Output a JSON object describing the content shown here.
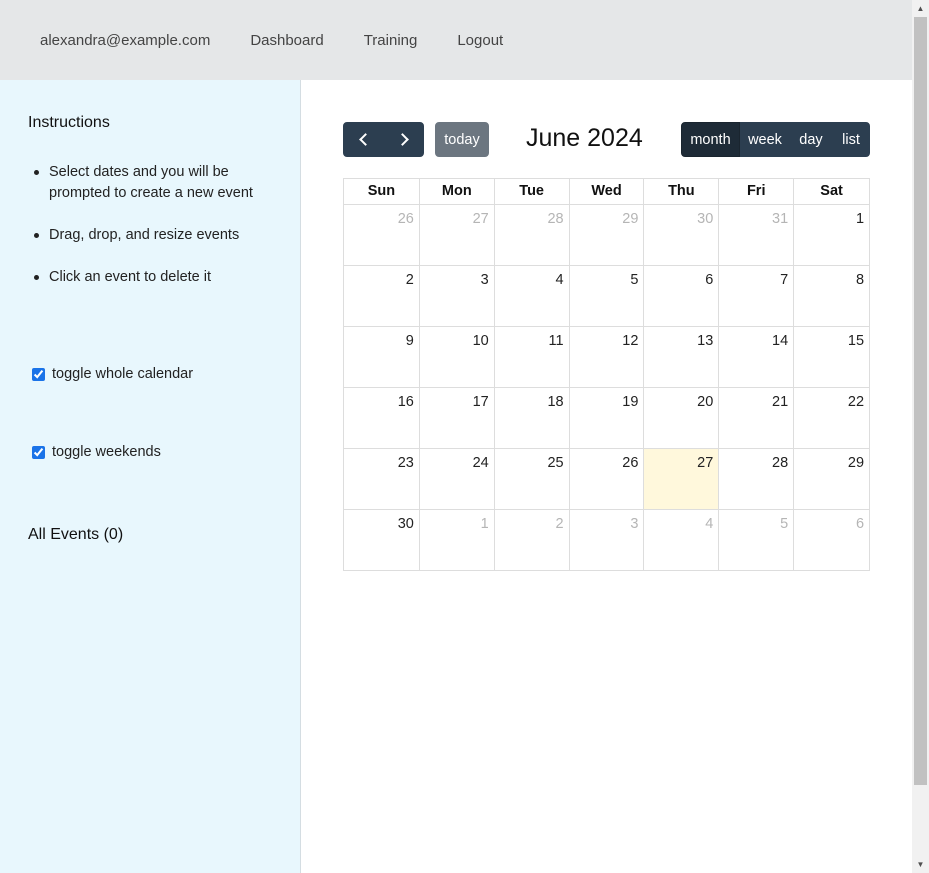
{
  "nav": {
    "user_email": "alexandra@example.com",
    "dashboard": "Dashboard",
    "training": "Training",
    "logout": "Logout"
  },
  "sidebar": {
    "instructions_title": "Instructions",
    "instructions": [
      "Select dates and you will be prompted to create a new event",
      "Drag, drop, and resize events",
      "Click an event to delete it"
    ],
    "toggle_calendar": {
      "label": "toggle whole calendar",
      "checked": true
    },
    "toggle_weekends": {
      "label": "toggle weekends",
      "checked": true
    },
    "events_title": "All Events (0)"
  },
  "calendar": {
    "title": "June 2024",
    "today_label": "today",
    "views": [
      "month",
      "week",
      "day",
      "list"
    ],
    "active_view": "month",
    "weekdays": [
      "Sun",
      "Mon",
      "Tue",
      "Wed",
      "Thu",
      "Fri",
      "Sat"
    ],
    "today_date": "27",
    "weeks": [
      [
        {
          "d": "26",
          "o": true
        },
        {
          "d": "27",
          "o": true
        },
        {
          "d": "28",
          "o": true
        },
        {
          "d": "29",
          "o": true
        },
        {
          "d": "30",
          "o": true
        },
        {
          "d": "31",
          "o": true
        },
        {
          "d": "1",
          "o": false
        }
      ],
      [
        {
          "d": "2",
          "o": false
        },
        {
          "d": "3",
          "o": false
        },
        {
          "d": "4",
          "o": false
        },
        {
          "d": "5",
          "o": false
        },
        {
          "d": "6",
          "o": false
        },
        {
          "d": "7",
          "o": false
        },
        {
          "d": "8",
          "o": false
        }
      ],
      [
        {
          "d": "9",
          "o": false
        },
        {
          "d": "10",
          "o": false
        },
        {
          "d": "11",
          "o": false
        },
        {
          "d": "12",
          "o": false
        },
        {
          "d": "13",
          "o": false
        },
        {
          "d": "14",
          "o": false
        },
        {
          "d": "15",
          "o": false
        }
      ],
      [
        {
          "d": "16",
          "o": false
        },
        {
          "d": "17",
          "o": false
        },
        {
          "d": "18",
          "o": false
        },
        {
          "d": "19",
          "o": false
        },
        {
          "d": "20",
          "o": false
        },
        {
          "d": "21",
          "o": false
        },
        {
          "d": "22",
          "o": false
        }
      ],
      [
        {
          "d": "23",
          "o": false
        },
        {
          "d": "24",
          "o": false
        },
        {
          "d": "25",
          "o": false
        },
        {
          "d": "26",
          "o": false
        },
        {
          "d": "27",
          "o": false
        },
        {
          "d": "28",
          "o": false
        },
        {
          "d": "29",
          "o": false
        }
      ],
      [
        {
          "d": "30",
          "o": false
        },
        {
          "d": "1",
          "o": true
        },
        {
          "d": "2",
          "o": true
        },
        {
          "d": "3",
          "o": true
        },
        {
          "d": "4",
          "o": true
        },
        {
          "d": "5",
          "o": true
        },
        {
          "d": "6",
          "o": true
        }
      ]
    ]
  },
  "colors": {
    "nav_bg": "#e5e7e8",
    "sidebar_bg": "#e8f7fd",
    "button_bg": "#2c3e50",
    "today_button_bg": "#6c7680",
    "today_cell_bg": "#fff8dc"
  }
}
